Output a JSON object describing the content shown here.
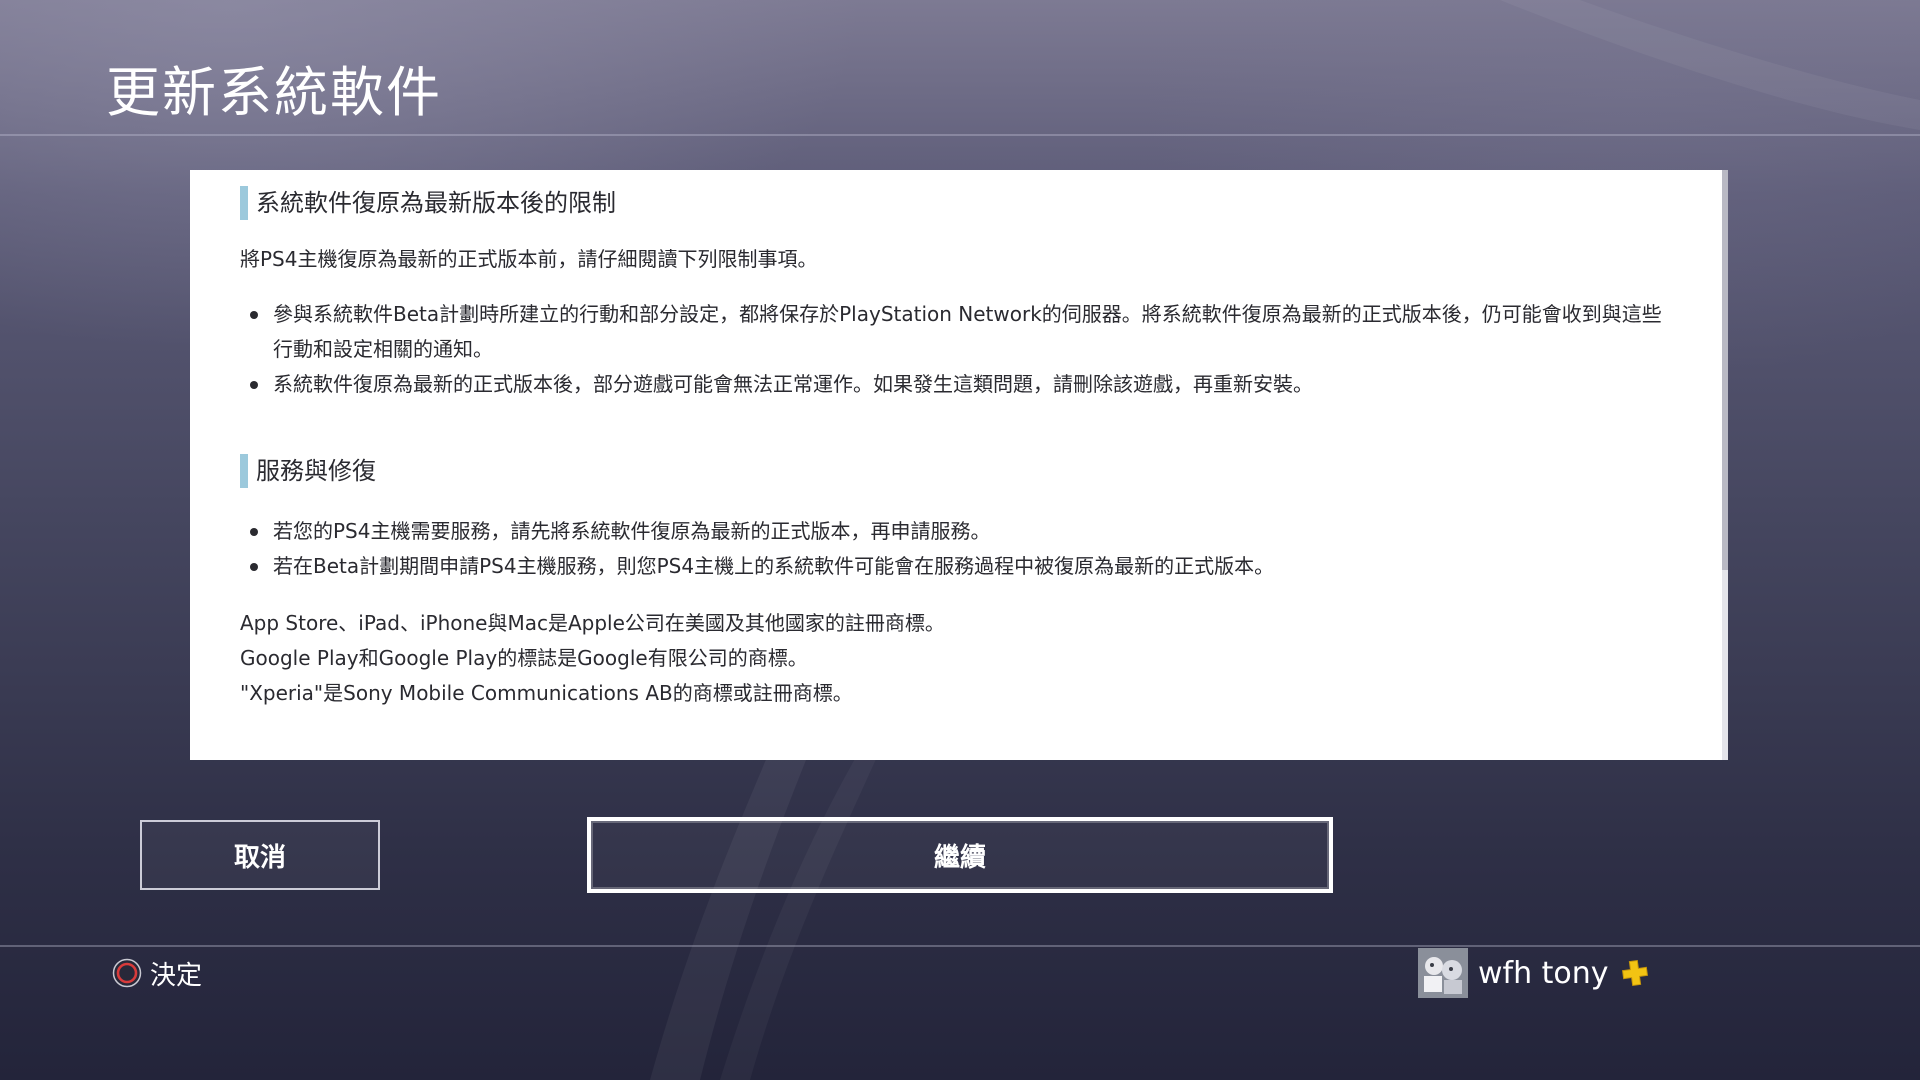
{
  "header": {
    "title": "更新系統軟件"
  },
  "content": {
    "section1": {
      "heading": "系統軟件復原為最新版本後的限制",
      "intro": "將PS4主機復原為最新的正式版本前，請仔細閱讀下列限制事項。",
      "bullets": [
        "參與系統軟件Beta計劃時所建立的行動和部分設定，都將保存於PlayStation Network的伺服器。將系統軟件復原為最新的正式版本後，仍可能會收到與這些行動和設定相關的通知。",
        "系統軟件復原為最新的正式版本後，部分遊戲可能會無法正常運作。如果發生這類問題，請刪除該遊戲，再重新安裝。"
      ]
    },
    "section2": {
      "heading": "服務與修復",
      "bullets": [
        "若您的PS4主機需要服務，請先將系統軟件復原為最新的正式版本，再申請服務。",
        "若在Beta計劃期間申請PS4主機服務，則您PS4主機上的系統軟件可能會在服務過程中被復原為最新的正式版本。"
      ]
    },
    "trademarks": [
      "App Store、iPad、iPhone與Mac是Apple公司在美國及其他國家的註冊商標。",
      "Google Play和Google Play的標誌是Google有限公司的商標。",
      "\"Xperia\"是Sony Mobile Communications AB的商標或註冊商標。"
    ]
  },
  "buttons": {
    "cancel_label": "取消",
    "continue_label": "繼續"
  },
  "footer": {
    "hint_icon": "circle-button-icon",
    "hint_label": "決定",
    "hint_color": "#d83b3b",
    "user_name": "wfh tony",
    "plus_icon": "playstation-plus-icon",
    "plus_color": "#f2c313"
  },
  "colors": {
    "heading_accent": "#9cc9dc",
    "panel_background": "#ffffff",
    "text": "#2a2a30"
  }
}
